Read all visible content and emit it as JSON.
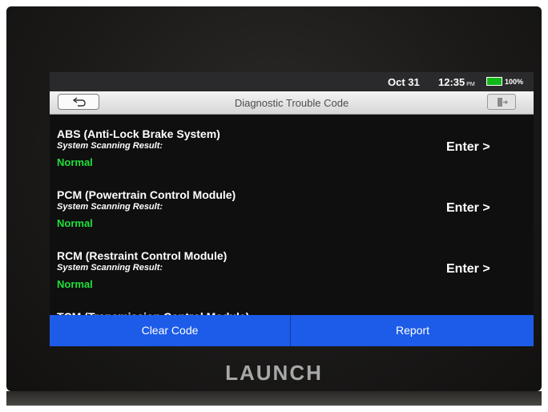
{
  "status_bar": {
    "date": "Oct 31",
    "time": "12:35",
    "ampm": "PM",
    "battery_percent": "100%",
    "battery_color": "#10b81a"
  },
  "header": {
    "title": "Diagnostic Trouble Code",
    "back_icon": "back-arrow-icon",
    "exit_icon": "exit-icon"
  },
  "systems": [
    {
      "name": "ABS (Anti-Lock Brake System)",
      "label": "System Scanning Result:",
      "result": "Normal",
      "action": "Enter >"
    },
    {
      "name": "PCM (Powertrain Control Module)",
      "label": "System Scanning Result:",
      "result": "Normal",
      "action": "Enter >"
    },
    {
      "name": "RCM (Restraint Control Module)",
      "label": "System Scanning Result:",
      "result": "Normal",
      "action": "Enter >"
    },
    {
      "name": "TCM (Transmission Control Module)"
    }
  ],
  "footer": {
    "clear_label": "Clear Code",
    "report_label": "Report"
  },
  "brand": "LAUNCH",
  "colors": {
    "accent": "#1d5ce8",
    "normal_status": "#1fe03a"
  }
}
